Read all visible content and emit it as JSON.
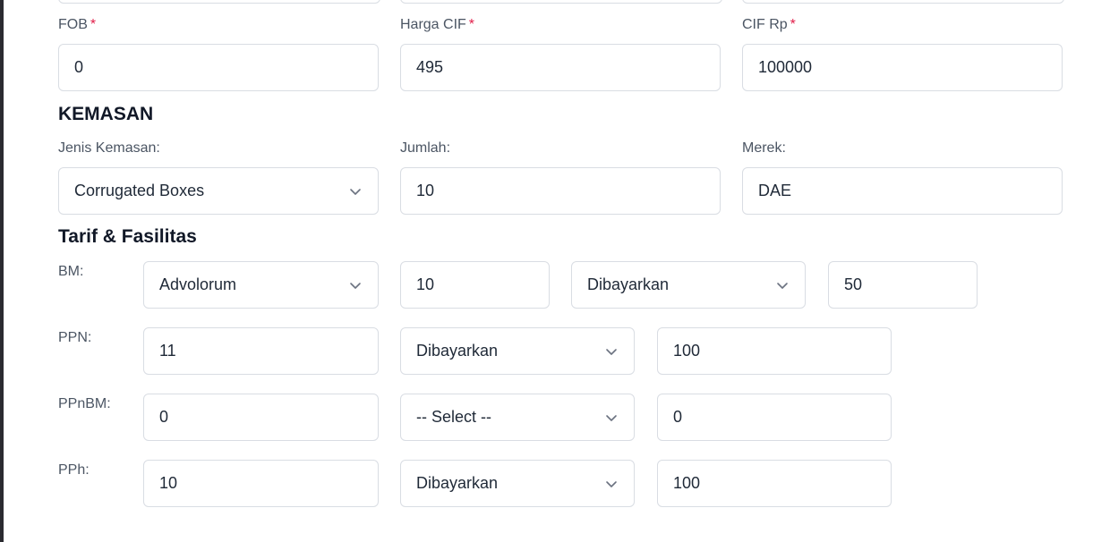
{
  "customs": {
    "fob": {
      "label": "FOB",
      "required_mark": "*",
      "value": "0"
    },
    "harga_cif": {
      "label": "Harga CIF",
      "required_mark": "*",
      "value": "495"
    },
    "cif_rp": {
      "label": "CIF Rp",
      "required_mark": "*",
      "value": "100000"
    }
  },
  "kemasan": {
    "title": "KEMASAN",
    "jenis_kemasan": {
      "label": "Jenis Kemasan:",
      "value": "Corrugated Boxes"
    },
    "jumlah": {
      "label": "Jumlah:",
      "value": "10"
    },
    "merek": {
      "label": "Merek:",
      "value": "DAE"
    }
  },
  "tarif": {
    "title": "Tarif & Fasilitas",
    "bm": {
      "label": "BM:",
      "type_value": "Advolorum",
      "rate": "10",
      "status": "Dibayarkan",
      "percent": "50"
    },
    "ppn": {
      "label": "PPN:",
      "rate": "11",
      "status": "Dibayarkan",
      "percent": "100"
    },
    "ppnbm": {
      "label": "PPnBM:",
      "rate": "0",
      "status": "-- Select --",
      "percent": "0"
    },
    "pph": {
      "label": "PPh:",
      "rate": "10",
      "status": "Dibayarkan",
      "percent": "100"
    }
  },
  "icons": {
    "dropdown": "chevron-down-icon"
  }
}
